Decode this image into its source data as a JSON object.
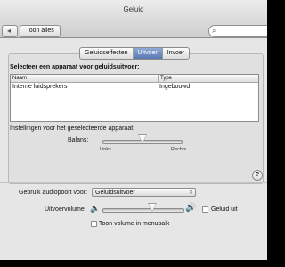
{
  "window": {
    "title": "Geluid"
  },
  "toolbar": {
    "back_icon": "grid-icon",
    "show_all_label": "Toon alles",
    "search_placeholder": "",
    "search_icon": "search-icon"
  },
  "tabs": [
    {
      "label": "Geluidseffecten",
      "selected": false
    },
    {
      "label": "Uitvoer",
      "selected": true
    },
    {
      "label": "Invoer",
      "selected": false
    }
  ],
  "output": {
    "heading": "Selecteer een apparaat voor geluidsuitvoer:",
    "columns": [
      "Naam",
      "Type"
    ],
    "rows": [
      {
        "name": "Interne luidsprekers",
        "type": "Ingebouwd"
      }
    ],
    "settings_label": "Instellingen voor het geselecteerde apparaat:",
    "balance": {
      "label": "Balans:",
      "left": "Links",
      "right": "Rechts",
      "value": 0.5
    },
    "help": "?"
  },
  "bottom": {
    "audio_port_label": "Gebruik audiopoort voor:",
    "audio_port_value": "Geluidsuitvoer",
    "volume_label": "Uitvoervolume:",
    "volume_value": 0.6,
    "mute_label": "Geluid uit",
    "mute_checked": false,
    "menubar_label": "Toon volume in menubalk",
    "menubar_checked": false
  }
}
